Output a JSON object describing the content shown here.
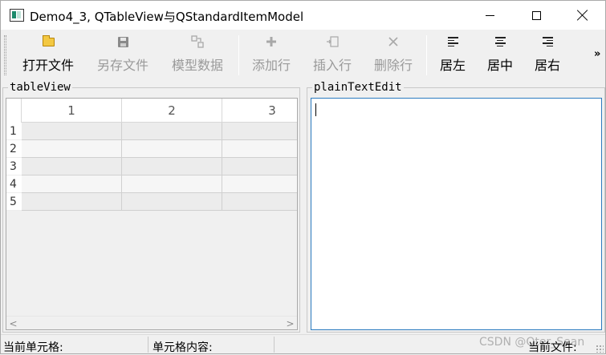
{
  "window": {
    "title": "Demo4_3, QTableView与QStandardItemModel"
  },
  "toolbar": {
    "items": [
      {
        "label": "打开文件",
        "icon": "folder-open-icon",
        "enabled": true
      },
      {
        "label": "另存文件",
        "icon": "save-icon",
        "enabled": false
      },
      {
        "label": "模型数据",
        "icon": "model-data-icon",
        "enabled": false
      },
      {
        "label": "添加行",
        "icon": "plus-icon",
        "enabled": false
      },
      {
        "label": "插入行",
        "icon": "insert-row-icon",
        "enabled": false
      },
      {
        "label": "删除行",
        "icon": "delete-icon",
        "enabled": false
      },
      {
        "label": "居左",
        "icon": "align-left-icon",
        "enabled": true
      },
      {
        "label": "居中",
        "icon": "align-center-icon",
        "enabled": true
      },
      {
        "label": "居右",
        "icon": "align-right-icon",
        "enabled": true
      }
    ],
    "overflow_label": "»"
  },
  "table_group": {
    "title": "tableView",
    "columns": [
      "1",
      "2",
      "3"
    ],
    "rows": [
      "1",
      "2",
      "3",
      "4",
      "5"
    ],
    "scroll_left": "<",
    "scroll_right": ">"
  },
  "text_group": {
    "title": "plainTextEdit",
    "content": ""
  },
  "statusbar": {
    "current_cell_label": "当前单元格:",
    "cell_content_label": "单元格内容:",
    "current_file_label": "当前文件:",
    "watermark": "CSDN @Qter_Sean"
  },
  "colors": {
    "focus_border": "#2b7bc0",
    "disabled_text": "#9a9a9a",
    "icon_gray": "#a8a8a8"
  }
}
